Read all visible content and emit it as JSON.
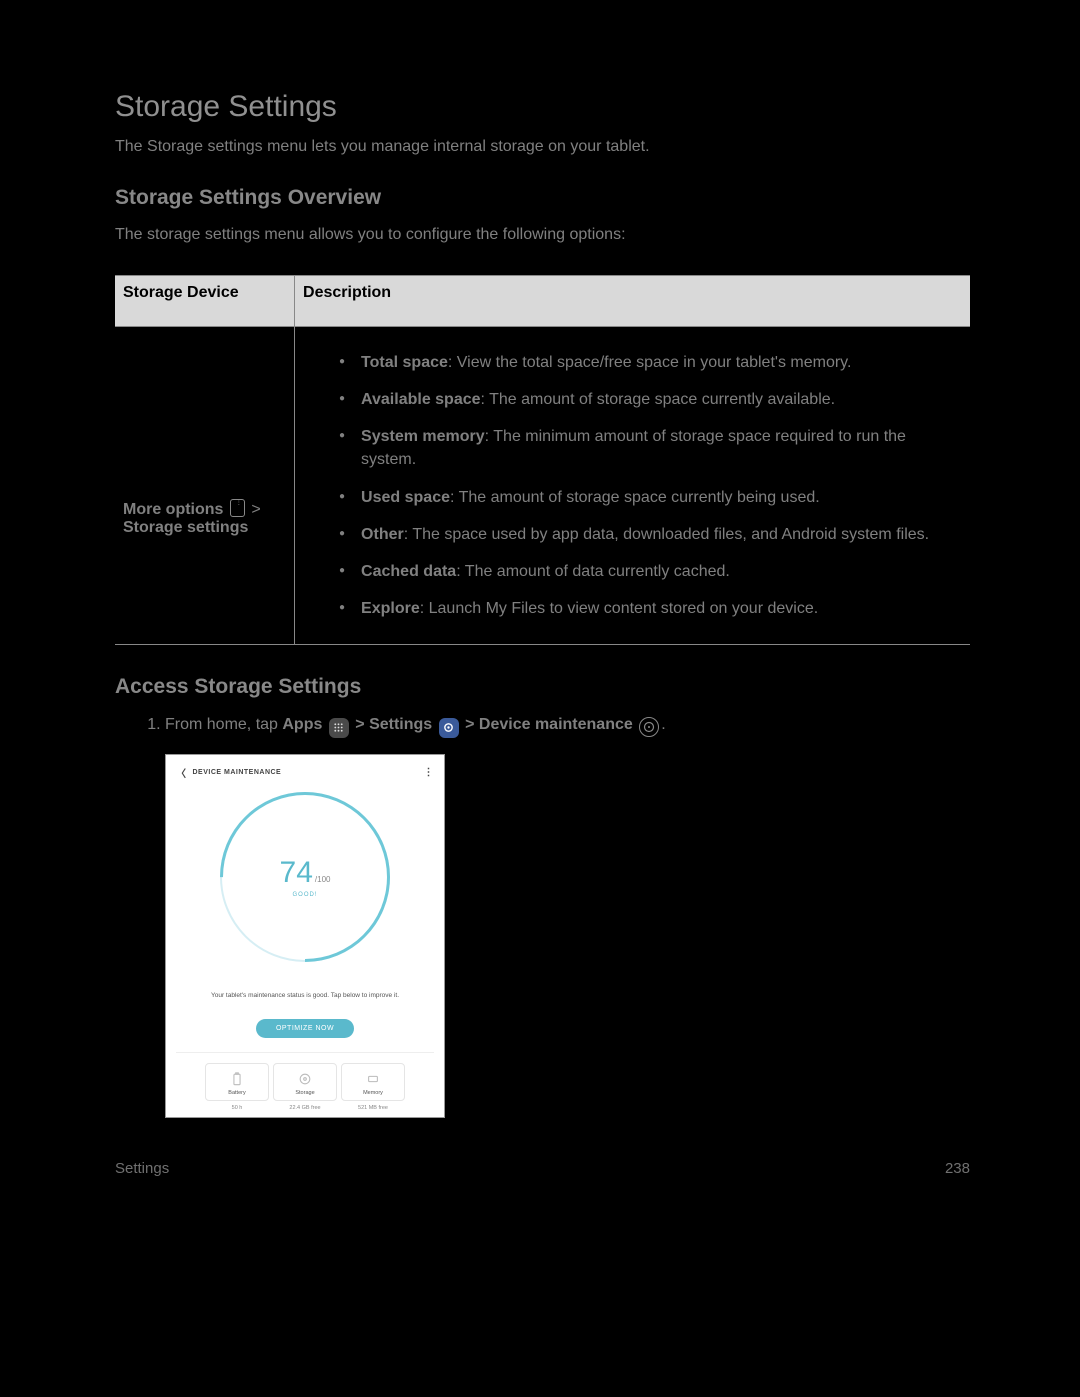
{
  "title": "Storage Settings",
  "intro": "The Storage settings menu lets you manage internal storage on your tablet.",
  "overview": {
    "heading": "Storage Settings Overview",
    "body": "The storage settings menu allows you to configure the following options:"
  },
  "table": {
    "header_left": "Storage Device",
    "header_right": "Description",
    "left_cell": {
      "label": "More options",
      "after_chevron": " >",
      "line2": "Storage settings"
    },
    "items": [
      {
        "bold": "Total space",
        "rest": ": View the total space/free space in your tablet's memory."
      },
      {
        "bold": "Available space",
        "rest": ": The amount of storage space currently available."
      },
      {
        "bold": "System memory",
        "rest": ": The minimum amount of storage space required to run the system."
      },
      {
        "bold": "Used space",
        "rest": ": The amount of storage space currently being used."
      },
      {
        "bold": "Other",
        "rest": ": The space used by app data, downloaded files, and Android system files."
      },
      {
        "bold": "Cached data",
        "rest": ": The amount of data currently cached."
      },
      {
        "bold": "Explore",
        "rest": ": Launch My Files to view content stored on your device."
      }
    ]
  },
  "access_heading": "Access Storage Settings",
  "access_step": {
    "prefix": "From home, tap ",
    "apps": "Apps",
    "chev1": " > ",
    "settings": "Settings",
    "chev2": " > ",
    "dm": "Device maintenance",
    "period": "."
  },
  "device_maintenance": {
    "title": "DEVICE MAINTENANCE",
    "score": "74",
    "score_max": "/100",
    "good": "GOOD!",
    "status": "Your tablet's maintenance status is good. Tap below to improve it.",
    "optimize": "OPTIMIZE NOW",
    "tiles": [
      {
        "name": "Battery",
        "sub": "50 h"
      },
      {
        "name": "Storage",
        "sub": "22.4 GB free"
      },
      {
        "name": "Memory",
        "sub": "521 MB free"
      }
    ]
  },
  "footer_left": "Settings",
  "footer_right": "238"
}
